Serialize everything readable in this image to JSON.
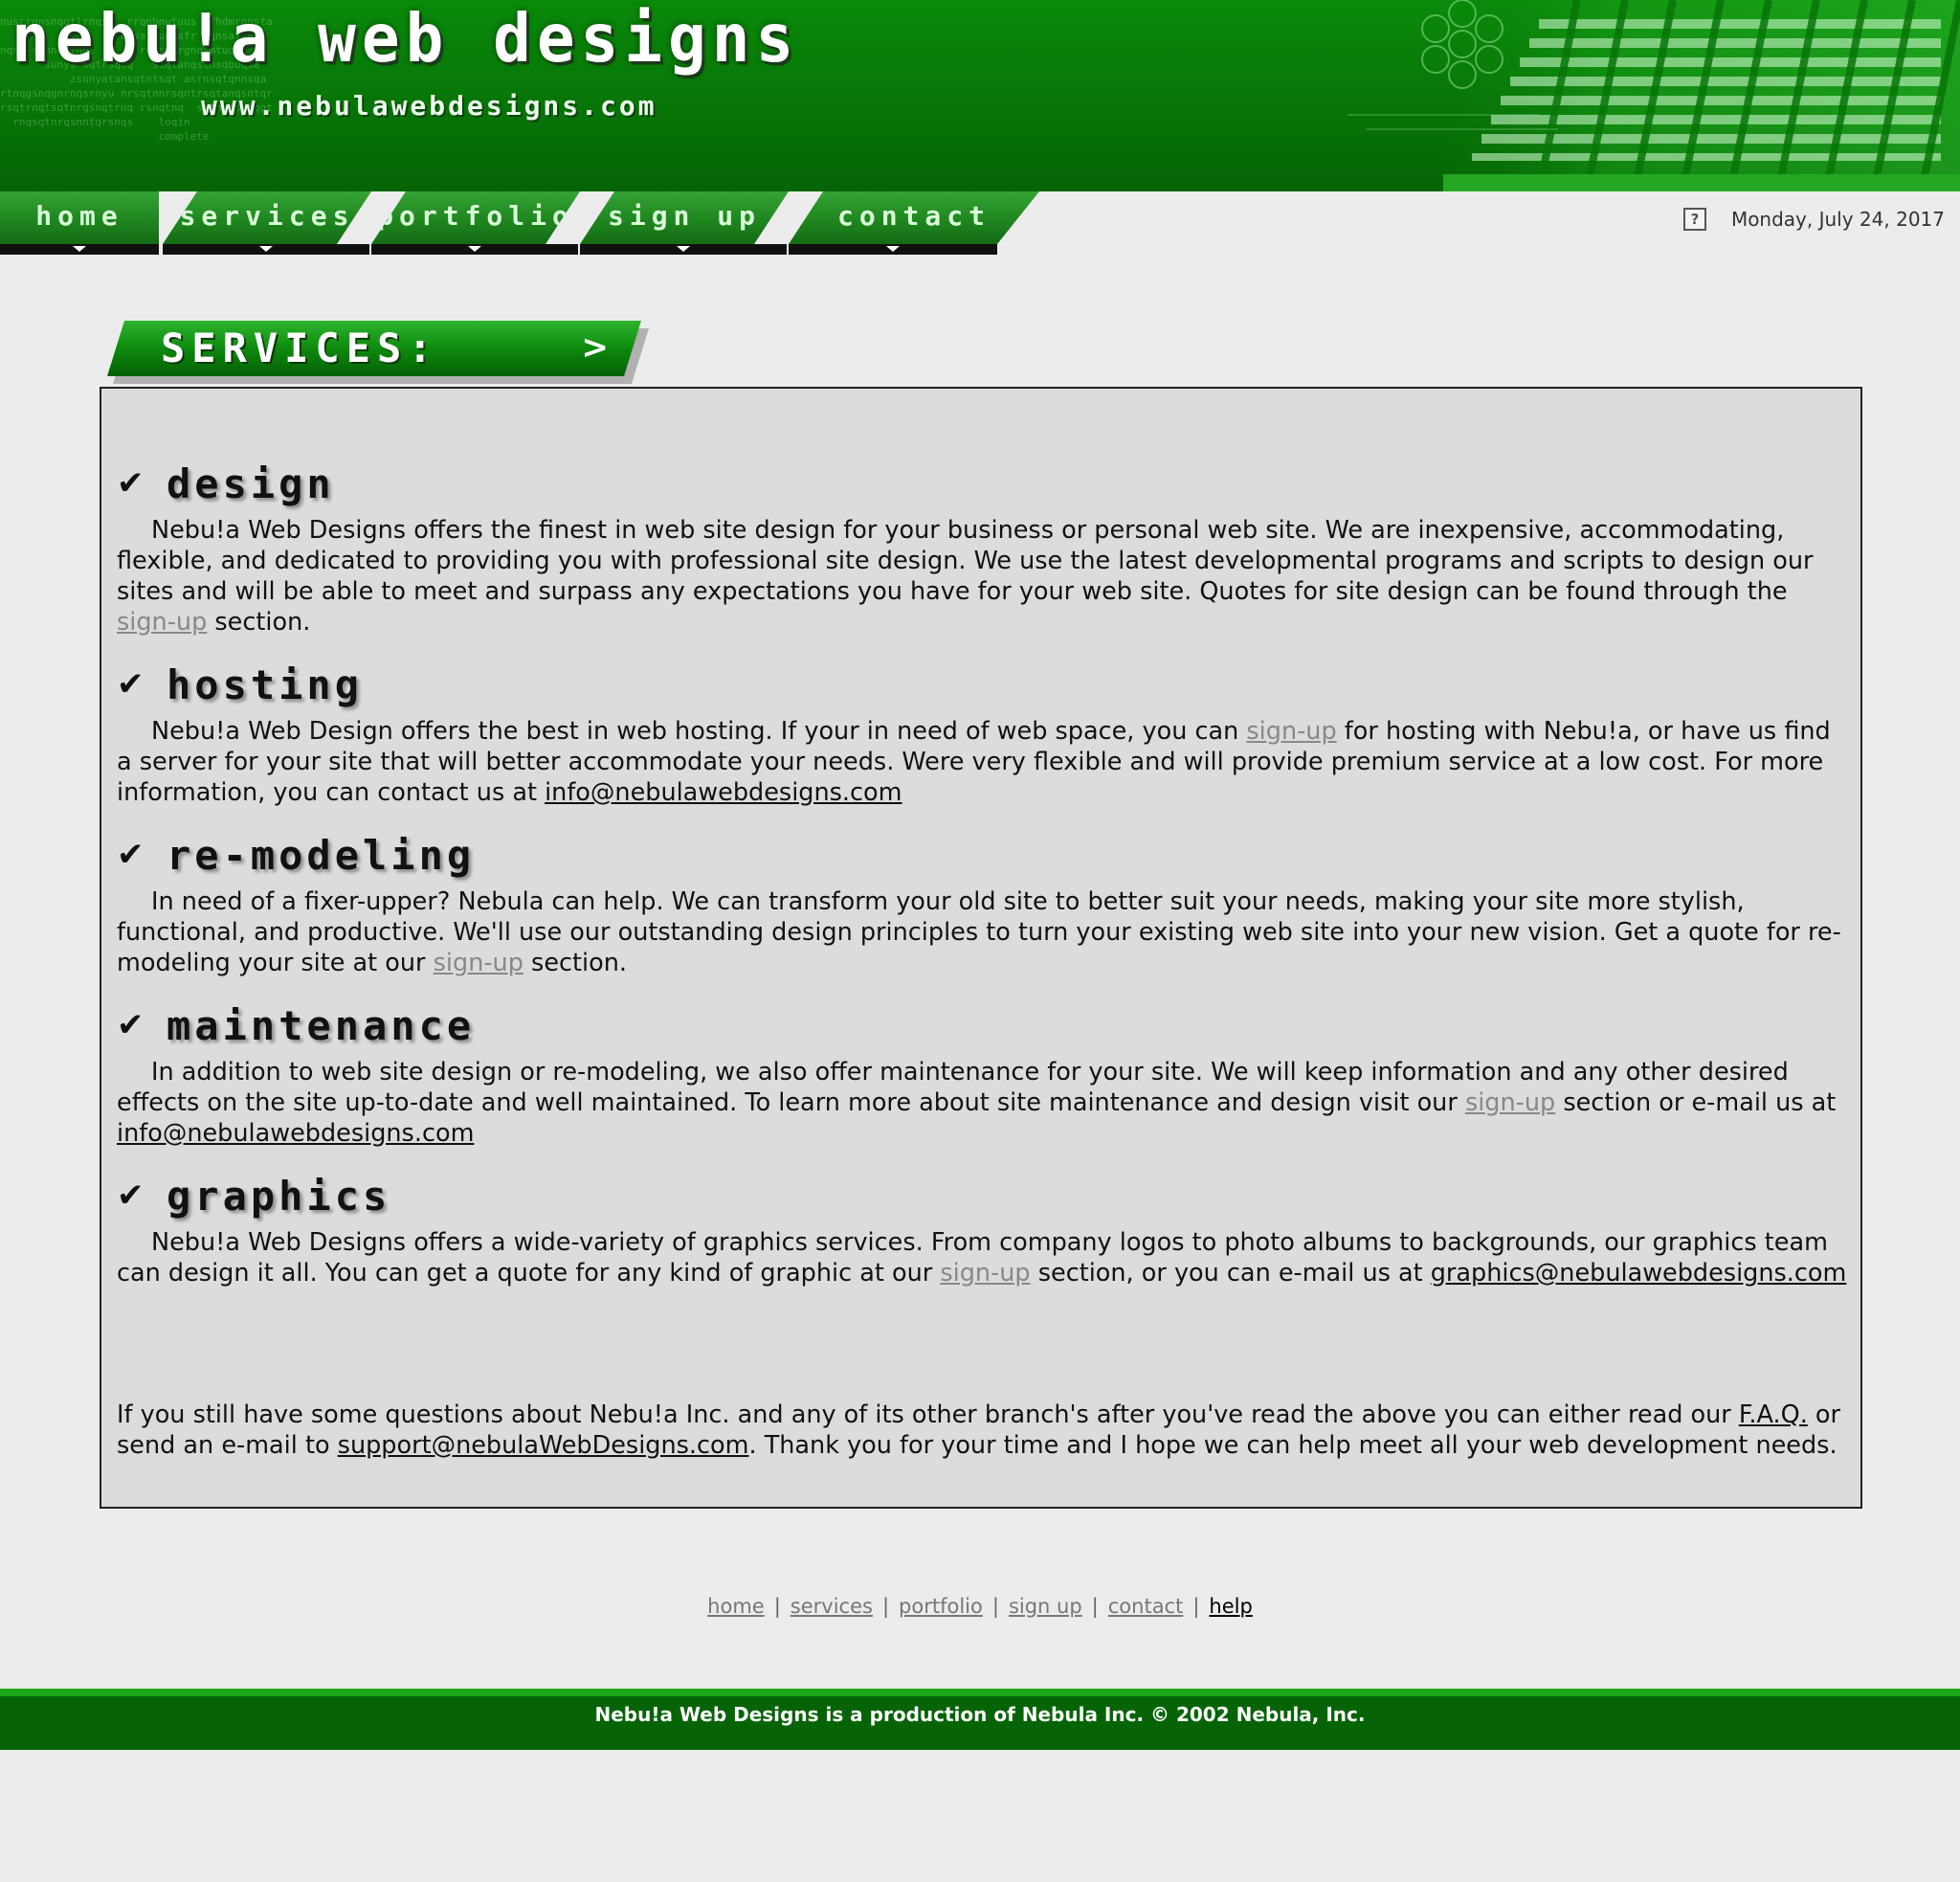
{
  "header": {
    "title": "nebu!a web designs",
    "url": "www.nebulawebdesigns.com"
  },
  "nav": {
    "items": [
      {
        "label": "home"
      },
      {
        "label": "services"
      },
      {
        "label": "portfolio"
      },
      {
        "label": "sign up"
      },
      {
        "label": "contact"
      }
    ]
  },
  "date": "Monday, July 24, 2017",
  "section": {
    "title": "SERVICES:"
  },
  "services": [
    {
      "title": "design",
      "p1": "Nebu!a Web Designs offers the finest in web site design for your business or personal web site. We are inexpensive, accommodating, flexible, and dedicated to providing you with professional site design. We use the latest developmental programs and scripts to design our sites and will be able to meet and surpass any expectations you have for your web site. Quotes for site design can be found through the ",
      "link1": "sign-up",
      "p2": " section."
    },
    {
      "title": "hosting",
      "p1": "Nebu!a Web Design offers the best in web hosting. If your in need of web space, you can ",
      "link1": "sign-up",
      "p2": " for hosting with Nebu!a, or have us find a server for your site that will better accommodate your needs. Were very flexible and will provide premium service at a low cost. For more information, you can contact us at ",
      "email": "info@nebulawebdesigns.com"
    },
    {
      "title": "re-modeling",
      "p1": "In need of a fixer-upper? Nebula can help. We can transform your old site to better suit your needs, making your site more stylish, functional, and productive. We'll use our outstanding design principles to turn your existing web site into your new vision. Get a quote for re-modeling your site at our ",
      "link1": "sign-up",
      "p2": " section."
    },
    {
      "title": "maintenance",
      "p1": "In addition to web site design or re-modeling, we also offer maintenance for your site. We will keep information and any other desired effects on the site up-to-date and well maintained. To learn more about site maintenance and design visit our ",
      "link1": "sign-up",
      "p2": " section or e-mail us at ",
      "email": "info@nebulawebdesigns.com"
    },
    {
      "title": "graphics",
      "p1": "Nebu!a Web Designs offers a wide-variety of graphics services. From company logos to photo albums to backgrounds, our graphics team can design it all. You can get a quote for any kind of graphic at our ",
      "link1": "sign-up",
      "p2": " section, or you can e-mail us at ",
      "email": "graphics@nebulawebdesigns.com"
    }
  ],
  "closing": {
    "p1": "If you still have some questions about Nebu!a Inc. and any of its other branch's after you've read the above you can either read our ",
    "faq": "F.A.Q.",
    "p2": " or send an e-mail to ",
    "email": "support@nebulaWebDesigns.com",
    "p3": ". Thank you for your time and I hope we can help meet all your web development needs."
  },
  "footer": {
    "links": [
      "home",
      "services",
      "portfolio",
      "sign up",
      "contact",
      "help"
    ],
    "separator": "|",
    "copyright": "Nebu!a Web Designs is a production of Nebula Inc. © 2002 Nebula, Inc."
  },
  "colors": {
    "brand_green": "#077507",
    "background": "#ececec",
    "content_bg": "#dcdcdc",
    "link_grey": "#888888"
  }
}
